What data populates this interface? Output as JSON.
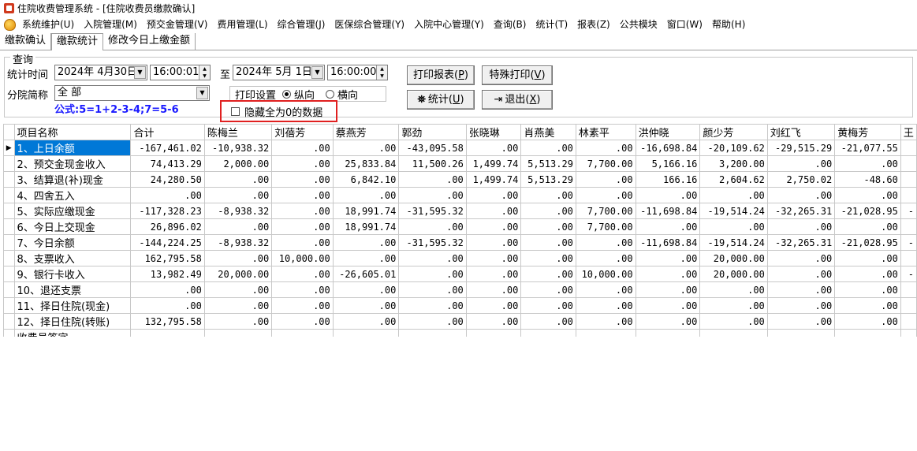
{
  "window": {
    "title": "住院收费管理系统 - [住院收费员缴款确认]"
  },
  "menu": [
    "系统维护(U)",
    "入院管理(M)",
    "预交金管理(V)",
    "费用管理(L)",
    "综合管理(J)",
    "医保综合管理(Y)",
    "入院中心管理(Y)",
    "查询(B)",
    "统计(T)",
    "报表(Z)",
    "公共模块",
    "窗口(W)",
    "帮助(H)"
  ],
  "tabs": [
    "缴款确认",
    "缴款统计",
    "修改今日上缴金额"
  ],
  "query": {
    "legend": "查询",
    "time_label": "统计时间",
    "start_date": "2024年 4月30日",
    "start_time": "16:00:01",
    "to_label": "至",
    "end_date": "2024年 5月 1日",
    "end_time": "16:00:00",
    "branch_label": "分院简称",
    "branch_value": "全 部",
    "formula": "公式:5=1+2-3-4;7=5-6",
    "print_setting_label": "打印设置",
    "portrait": "纵向",
    "landscape": "横向",
    "hide_zero": "隐藏全为0的数据"
  },
  "buttons": {
    "print_report": "打印报表(",
    "print_report_key": "P",
    "print_report_end": ")",
    "special_print": "特殊打印(",
    "special_print_key": "V",
    "special_print_end": ")",
    "stats": "统计(",
    "stats_key": "U",
    "stats_end": ")",
    "exit": "退出(",
    "exit_key": "X",
    "exit_end": ")"
  },
  "table": {
    "headers": [
      "项目名称",
      "合计",
      "陈梅兰",
      "刘蓓芳",
      "蔡燕芳",
      "郭劲",
      "张晓琳",
      "肖燕美",
      "林素平",
      "洪仲晓",
      "颜少芳",
      "刘红飞",
      "黄梅芳",
      "王"
    ],
    "rows": [
      [
        "1、上日余额",
        "-167,461.02",
        "-10,938.32",
        ".00",
        ".00",
        "-43,095.58",
        ".00",
        ".00",
        ".00",
        "-16,698.84",
        "-20,109.62",
        "-29,515.29",
        "-21,077.55",
        ""
      ],
      [
        "2、预交金现金收入",
        "74,413.29",
        "2,000.00",
        ".00",
        "25,833.84",
        "11,500.26",
        "1,499.74",
        "5,513.29",
        "7,700.00",
        "5,166.16",
        "3,200.00",
        ".00",
        ".00",
        ""
      ],
      [
        "3、结算退(补)现金",
        "24,280.50",
        ".00",
        ".00",
        "6,842.10",
        ".00",
        "1,499.74",
        "5,513.29",
        ".00",
        "166.16",
        "2,604.62",
        "2,750.02",
        "-48.60",
        ""
      ],
      [
        "4、四舍五入",
        ".00",
        ".00",
        ".00",
        ".00",
        ".00",
        ".00",
        ".00",
        ".00",
        ".00",
        ".00",
        ".00",
        ".00",
        ""
      ],
      [
        "5、实际应缴现金",
        "-117,328.23",
        "-8,938.32",
        ".00",
        "18,991.74",
        "-31,595.32",
        ".00",
        ".00",
        "7,700.00",
        "-11,698.84",
        "-19,514.24",
        "-32,265.31",
        "-21,028.95",
        "-"
      ],
      [
        "6、今日上交现金",
        "26,896.02",
        ".00",
        ".00",
        "18,991.74",
        ".00",
        ".00",
        ".00",
        "7,700.00",
        ".00",
        ".00",
        ".00",
        ".00",
        ""
      ],
      [
        "7、今日余额",
        "-144,224.25",
        "-8,938.32",
        ".00",
        ".00",
        "-31,595.32",
        ".00",
        ".00",
        ".00",
        "-11,698.84",
        "-19,514.24",
        "-32,265.31",
        "-21,028.95",
        "-"
      ],
      [
        "8、支票收入",
        "162,795.58",
        ".00",
        "10,000.00",
        ".00",
        ".00",
        ".00",
        ".00",
        ".00",
        ".00",
        "20,000.00",
        ".00",
        ".00",
        ""
      ],
      [
        "9、银行卡收入",
        "13,982.49",
        "20,000.00",
        ".00",
        "-26,605.01",
        ".00",
        ".00",
        ".00",
        "10,000.00",
        ".00",
        "20,000.00",
        ".00",
        ".00",
        "-"
      ],
      [
        "10、退还支票",
        ".00",
        ".00",
        ".00",
        ".00",
        ".00",
        ".00",
        ".00",
        ".00",
        ".00",
        ".00",
        ".00",
        ".00",
        ""
      ],
      [
        "11、择日住院(现金)",
        ".00",
        ".00",
        ".00",
        ".00",
        ".00",
        ".00",
        ".00",
        ".00",
        ".00",
        ".00",
        ".00",
        ".00",
        ""
      ],
      [
        "12、择日住院(转账)",
        "132,795.58",
        ".00",
        ".00",
        ".00",
        ".00",
        ".00",
        ".00",
        ".00",
        ".00",
        ".00",
        ".00",
        ".00",
        ""
      ],
      [
        "收费员签字",
        "",
        "",
        "",
        "",
        "",
        "",
        "",
        "",
        "",
        "",
        "",
        "",
        ""
      ]
    ]
  }
}
